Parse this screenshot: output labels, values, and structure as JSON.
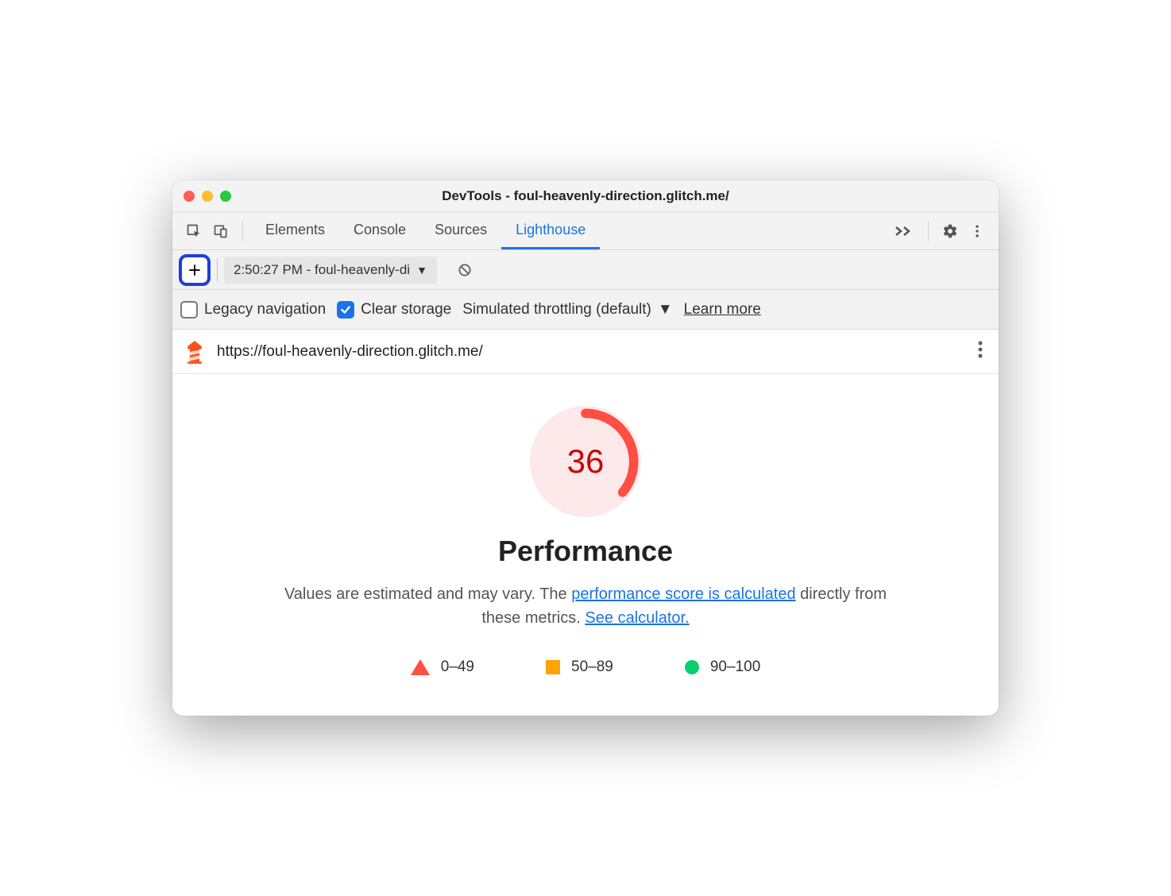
{
  "window": {
    "title": "DevTools - foul-heavenly-direction.glitch.me/"
  },
  "tabs": {
    "items": [
      "Elements",
      "Console",
      "Sources",
      "Lighthouse"
    ],
    "active": "Lighthouse"
  },
  "controls": {
    "report_select": "2:50:27 PM - foul-heavenly-di"
  },
  "options": {
    "legacy_label": "Legacy navigation",
    "legacy_checked": false,
    "clear_label": "Clear storage",
    "clear_checked": true,
    "throttling": "Simulated throttling (default)",
    "learn_more": "Learn more"
  },
  "report": {
    "url": "https://foul-heavenly-direction.glitch.me/",
    "score": "36",
    "category": "Performance",
    "desc_pre": "Values are estimated and may vary. The ",
    "desc_link1": "performance score is calculated",
    "desc_mid": " directly from these metrics. ",
    "desc_link2": "See calculator.",
    "legend": {
      "fail": "0–49",
      "avg": "50–89",
      "pass": "90–100"
    }
  },
  "chart_data": {
    "type": "pie",
    "title": "Performance",
    "values": [
      36
    ],
    "max": 100,
    "color": "#ff4e42",
    "ranges": [
      {
        "label": "0–49",
        "color": "#ff4e42"
      },
      {
        "label": "50–89",
        "color": "#ffa400"
      },
      {
        "label": "90–100",
        "color": "#0cce6b"
      }
    ]
  }
}
